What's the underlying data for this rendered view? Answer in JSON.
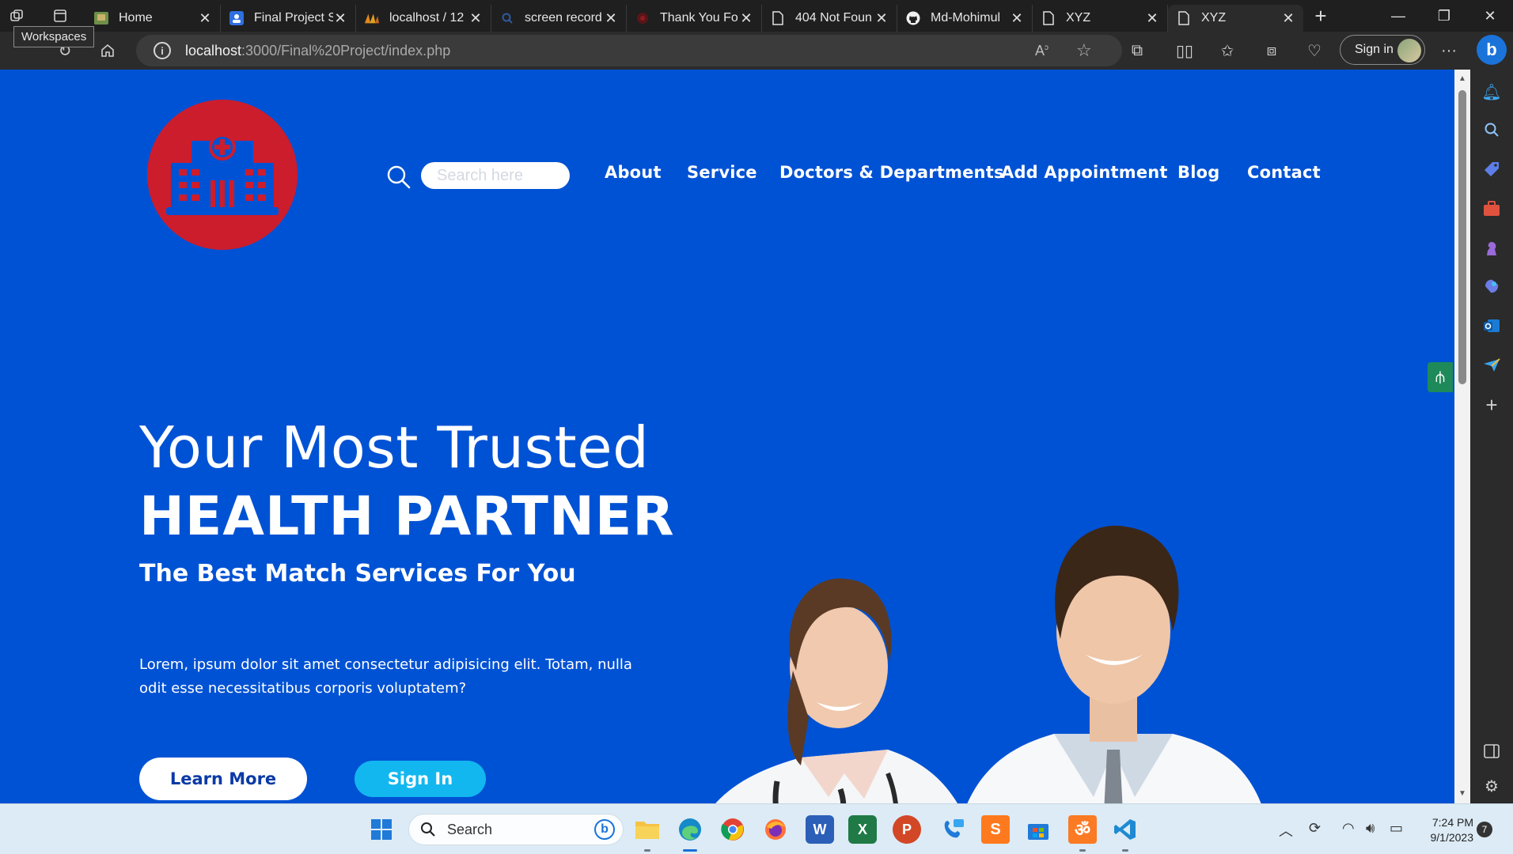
{
  "browser": {
    "workspaces_tooltip": "Workspaces",
    "tabs": [
      {
        "title": "Home",
        "icon": "photo-favicon-icon"
      },
      {
        "title": "Final Project S",
        "icon": "contacts-favicon-icon"
      },
      {
        "title": "localhost / 12",
        "icon": "phpmyadmin-favicon-icon"
      },
      {
        "title": "screen record",
        "icon": "search-favicon-icon"
      },
      {
        "title": "Thank You Fo",
        "icon": "red-favicon-icon"
      },
      {
        "title": "404 Not Foun",
        "icon": "page-icon"
      },
      {
        "title": "Md-Mohimul",
        "icon": "github-icon"
      },
      {
        "title": "XYZ",
        "icon": "page-icon"
      },
      {
        "title": "XYZ",
        "icon": "page-icon",
        "active": true
      }
    ],
    "address": {
      "host": "localhost",
      "path": ":3000/Final%20Project/index.php"
    },
    "sign_in_label": "Sign in",
    "more_label": "···"
  },
  "site": {
    "search_placeholder": "Search here",
    "menu": [
      "About",
      "Service",
      "Doctors & Departments",
      "Add Appointment",
      "Blog",
      "Contact"
    ],
    "hero": {
      "line1": "Your Most Trusted",
      "line2": "HEALTH PARTNER",
      "subtitle": "The Best Match Services For You",
      "paragraph": "Lorem, ipsum dolor sit amet consectetur adipisicing elit. Totam, nulla odit esse necessitatibus corporis voluptatem?",
      "learn_more": "Learn More",
      "sign_in": "Sign In"
    },
    "colors": {
      "background": "#0052d4",
      "logo_red": "#cc1d2d",
      "signin_button": "#13b7f0"
    }
  },
  "taskbar": {
    "search_label": "Search",
    "time": "7:24 PM",
    "date": "9/1/2023",
    "notifications": "7"
  }
}
